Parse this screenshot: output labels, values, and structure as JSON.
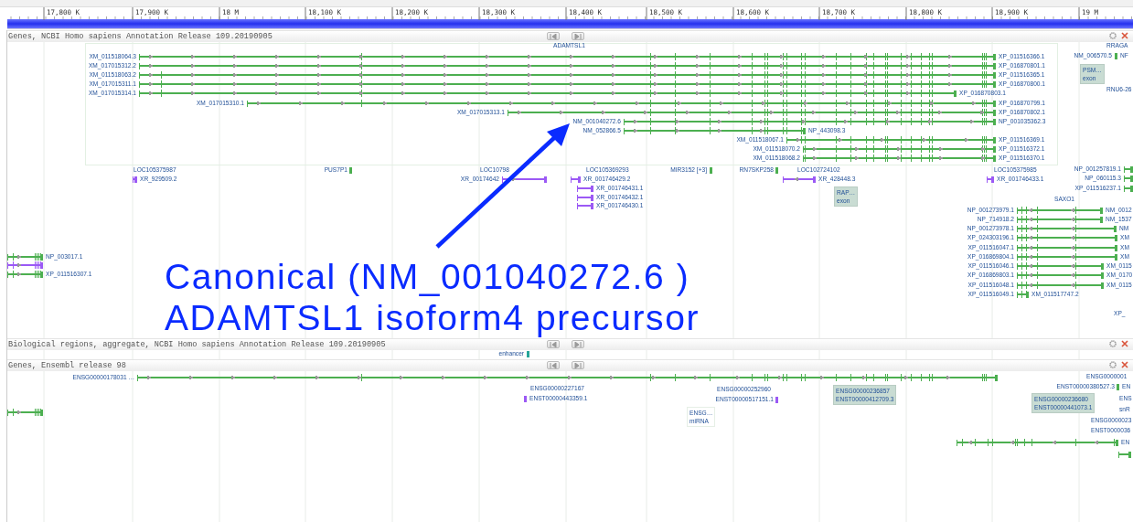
{
  "ruler": {
    "ticks": [
      "17,800 K",
      "17,900 K",
      "18 M",
      "18,100 K",
      "18,200 K",
      "18,300 K",
      "18,400 K",
      "18,500 K",
      "18,600 K",
      "18,700 K",
      "18,800 K",
      "18,900 K",
      "19 M"
    ]
  },
  "tracks": [
    {
      "title": "Genes, NCBI Homo sapiens Annotation Release 109.20190905",
      "features": [
        {
          "kind": "label",
          "text": "ADAMTSL1"
        },
        {
          "kind": "transcript",
          "left": "XM_011518064.3",
          "right": "XP_011516366.1",
          "color": "#4caf50"
        },
        {
          "kind": "transcript",
          "left": "XM_017015312.2",
          "right": "XP_016870801.1",
          "color": "#4caf50"
        },
        {
          "kind": "transcript",
          "left": "XM_011518063.2",
          "right": "XP_011516365.1",
          "color": "#4caf50"
        },
        {
          "kind": "transcript",
          "left": "XM_017015311.1",
          "right": "XP_016870800.1",
          "color": "#4caf50"
        },
        {
          "kind": "transcript",
          "left": "XM_017015314.1",
          "right": "XP_016870803.1",
          "color": "#4caf50"
        },
        {
          "kind": "transcript",
          "left": "XM_017015310.1",
          "right": "XP_016870799.1",
          "color": "#4caf50"
        },
        {
          "kind": "transcript",
          "left": "XM_017015313.1",
          "right": "XP_016870802.1",
          "color": "#4caf50"
        },
        {
          "kind": "transcript",
          "left": "NM_001040272.6",
          "right": "NP_001035362.3",
          "color": "#4caf50"
        },
        {
          "kind": "transcript",
          "left": "NM_052866.5",
          "right": "NP_443098.3",
          "color": "#4caf50"
        },
        {
          "kind": "transcript",
          "left": "XM_011518067.1",
          "right": "XP_011516369.1",
          "color": "#4caf50"
        },
        {
          "kind": "transcript",
          "left": "XM_011518070.2",
          "right": "XP_011516372.1",
          "color": "#4caf50"
        },
        {
          "kind": "transcript",
          "left": "XM_011518068.2",
          "right": "XP_011516370.1",
          "color": "#4caf50"
        },
        {
          "kind": "label",
          "text": "RRAGA"
        },
        {
          "kind": "transcript",
          "left": "NM_006570.5",
          "right": "NF",
          "color": "#4caf50"
        },
        {
          "kind": "box",
          "lines": [
            "PSM…",
            "exon"
          ],
          "highlighted": true
        },
        {
          "kind": "label",
          "text": "RNU6-26"
        },
        {
          "kind": "label",
          "text": "LOC105375987"
        },
        {
          "kind": "transcript",
          "right": "XR_929509.2",
          "color": "#9b59f5"
        },
        {
          "kind": "transcript",
          "left": "PUS7P1",
          "color": "#4caf50"
        },
        {
          "kind": "label",
          "text": "LOC10798"
        },
        {
          "kind": "transcript",
          "left": "XR_00174642",
          "color": "#9b59f5"
        },
        {
          "kind": "label",
          "text": "LOC105369293"
        },
        {
          "kind": "transcript",
          "right": "XR_001746429.2",
          "color": "#9b59f5"
        },
        {
          "kind": "transcript",
          "right": "XR_001746431.1",
          "color": "#9b59f5"
        },
        {
          "kind": "transcript",
          "right": "XR_001746432.1",
          "color": "#9b59f5"
        },
        {
          "kind": "transcript",
          "right": "XR_001746430.1",
          "color": "#9b59f5"
        },
        {
          "kind": "transcript",
          "left": "MIR3152 [+3]",
          "color": "#4caf50"
        },
        {
          "kind": "transcript",
          "left": "RN7SKP258",
          "color": "#4caf50"
        },
        {
          "kind": "label",
          "text": "LOC102724102"
        },
        {
          "kind": "transcript",
          "right": "XR_428448.3",
          "color": "#9b59f5"
        },
        {
          "kind": "box",
          "lines": [
            "RAP…",
            "exon"
          ],
          "highlighted": true
        },
        {
          "kind": "label",
          "text": "LOC105375985"
        },
        {
          "kind": "transcript",
          "right": "XR_001746433.1",
          "color": "#9b59f5"
        },
        {
          "kind": "transcript",
          "left": "NP_001257819.1",
          "color": "#4caf50"
        },
        {
          "kind": "transcript",
          "left": "NP_060115.3",
          "color": "#4caf50"
        },
        {
          "kind": "transcript",
          "left": "XP_011516237.1",
          "color": "#4caf50"
        },
        {
          "kind": "label",
          "text": "SAXO1"
        },
        {
          "kind": "transcript",
          "left": "NP_001273979.1",
          "right": "NM_0012",
          "color": "#4caf50"
        },
        {
          "kind": "transcript",
          "left": "NP_714918.2",
          "right": "NM_1537",
          "color": "#4caf50"
        },
        {
          "kind": "transcript",
          "left": "NP_001273978.1",
          "right": "NM",
          "color": "#4caf50"
        },
        {
          "kind": "transcript",
          "left": "XP_024303196.1",
          "right": "XM",
          "color": "#4caf50"
        },
        {
          "kind": "transcript",
          "left": "XP_011516047.1",
          "right": "XM",
          "color": "#4caf50"
        },
        {
          "kind": "transcript",
          "left": "XP_016869804.1",
          "right": "XM",
          "color": "#4caf50"
        },
        {
          "kind": "transcript",
          "left": "XP_011516046.1",
          "right": "XM_0115",
          "color": "#4caf50"
        },
        {
          "kind": "transcript",
          "left": "XP_016869803.1",
          "right": "XM_0170",
          "color": "#4caf50"
        },
        {
          "kind": "transcript",
          "left": "XP_011516048.1",
          "right": "XM_0115",
          "color": "#4caf50"
        },
        {
          "kind": "transcript",
          "left": "XP_011516049.1",
          "right": "XM_011517747.2",
          "color": "#4caf50"
        },
        {
          "kind": "label",
          "text": "XP_"
        },
        {
          "kind": "transcript",
          "right": "NP_003017.1",
          "color": "#4caf50"
        },
        {
          "kind": "transcript",
          "color": "#9b59f5"
        },
        {
          "kind": "transcript",
          "right": "XP_011516307.1",
          "color": "#4caf50"
        }
      ]
    },
    {
      "title": "Biological regions, aggregate, NCBI Homo sapiens Annotation Release 109.20190905",
      "features": [
        {
          "kind": "transcript",
          "left": "enhancer",
          "color": "#26a69a"
        }
      ]
    },
    {
      "title": "Genes, Ensembl release 98",
      "features": [
        {
          "kind": "transcript",
          "left": "ENSG00000178031 …",
          "color": "#4caf50"
        },
        {
          "kind": "label",
          "text": "ENSG00000227167"
        },
        {
          "kind": "transcript",
          "right": "ENST00000443359.1",
          "color": "#9b59f5"
        },
        {
          "kind": "label",
          "text": "ENSG00000252960"
        },
        {
          "kind": "transcript",
          "left": "ENST00000517151.1",
          "color": "#9b59f5"
        },
        {
          "kind": "box",
          "lines": [
            "ENSG00000236857",
            "ENST00000412709.3"
          ],
          "highlighted": true
        },
        {
          "kind": "label",
          "text": "ENSG0000001"
        },
        {
          "kind": "transcript",
          "left": "ENST00000380527.3",
          "right": "EN",
          "color": "#4caf50"
        },
        {
          "kind": "box",
          "lines": [
            "ENSG…",
            "miRNA"
          ],
          "highlighted": false
        },
        {
          "kind": "box",
          "lines": [
            "ENSG00000236680",
            "ENST00000441073.1"
          ],
          "highlighted": true
        },
        {
          "kind": "label",
          "text": "ENS"
        },
        {
          "kind": "label",
          "text": "snR"
        },
        {
          "kind": "label",
          "text": "ENSG0000023"
        },
        {
          "kind": "label",
          "text": "ENST0000036"
        },
        {
          "kind": "transcript",
          "right": "EN",
          "color": "#4caf50"
        },
        {
          "kind": "transcript",
          "color": "#4caf50"
        },
        {
          "kind": "transcript",
          "color": "#4caf50"
        }
      ]
    }
  ],
  "annotation": {
    "lines": [
      "Canonical (NM_001040272.6 )",
      "ADAMTSL1 isoform4 precursor"
    ]
  }
}
